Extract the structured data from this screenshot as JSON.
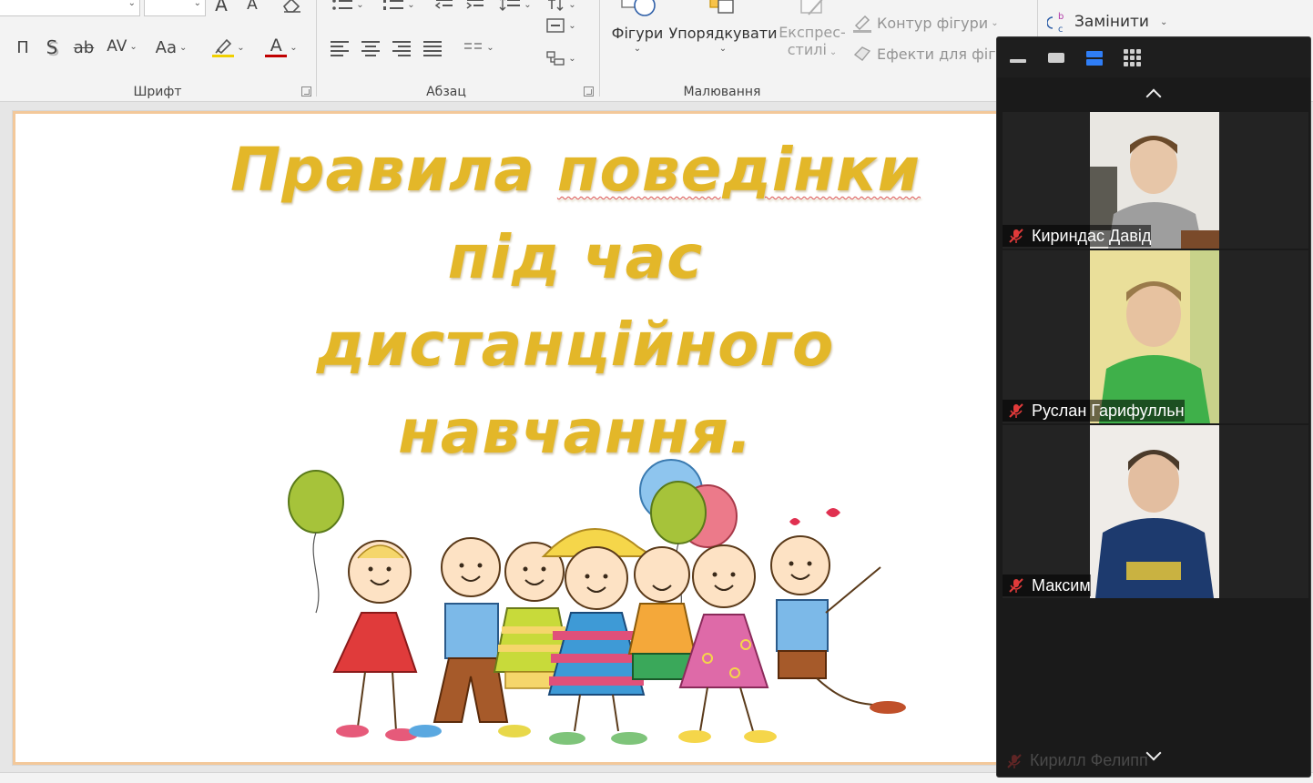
{
  "ribbon": {
    "font_group": {
      "caption": "Шрифт",
      "grow_font": "A",
      "shrink_font": "A",
      "underline": "П",
      "shadow": "S",
      "strikethrough": "ab",
      "char_spacing": "AV",
      "change_case": "Aa",
      "font_color_letter": "A",
      "highlight_color": "#f0d000",
      "font_color": "#c00000"
    },
    "paragraph_group": {
      "caption": "Абзац"
    },
    "drawing_group": {
      "caption": "Малювання",
      "shapes_label": "Фігури",
      "arrange_label": "Упорядкувати",
      "quick_styles_label_1": "Експрес-",
      "quick_styles_label_2": "стилі",
      "shape_outline_label": "Контур фігури",
      "shape_effects_label": "Ефекти для фігур"
    },
    "editing_group": {
      "replace_label": "Замінити"
    }
  },
  "slide": {
    "title_lines": [
      "Правила поведінки",
      "під час",
      "дистанційного",
      "навчання."
    ],
    "title_color": "#e3b729",
    "border_color": "#f3c89a"
  },
  "zoom": {
    "accent": "#2f7ef7",
    "participants": [
      {
        "name": "Кириндас Давід",
        "muted": true,
        "shirt": "#9e9e9e",
        "bg": "#e9e7e2"
      },
      {
        "name": "Руслан Гарифулльн",
        "muted": true,
        "shirt": "#3fb04a",
        "bg": "#eadf9a"
      },
      {
        "name": "Максим",
        "muted": true,
        "shirt": "#1d3a6e",
        "bg": "#efece8"
      },
      {
        "name": "Кирилл Фелипп",
        "muted": true
      }
    ]
  }
}
